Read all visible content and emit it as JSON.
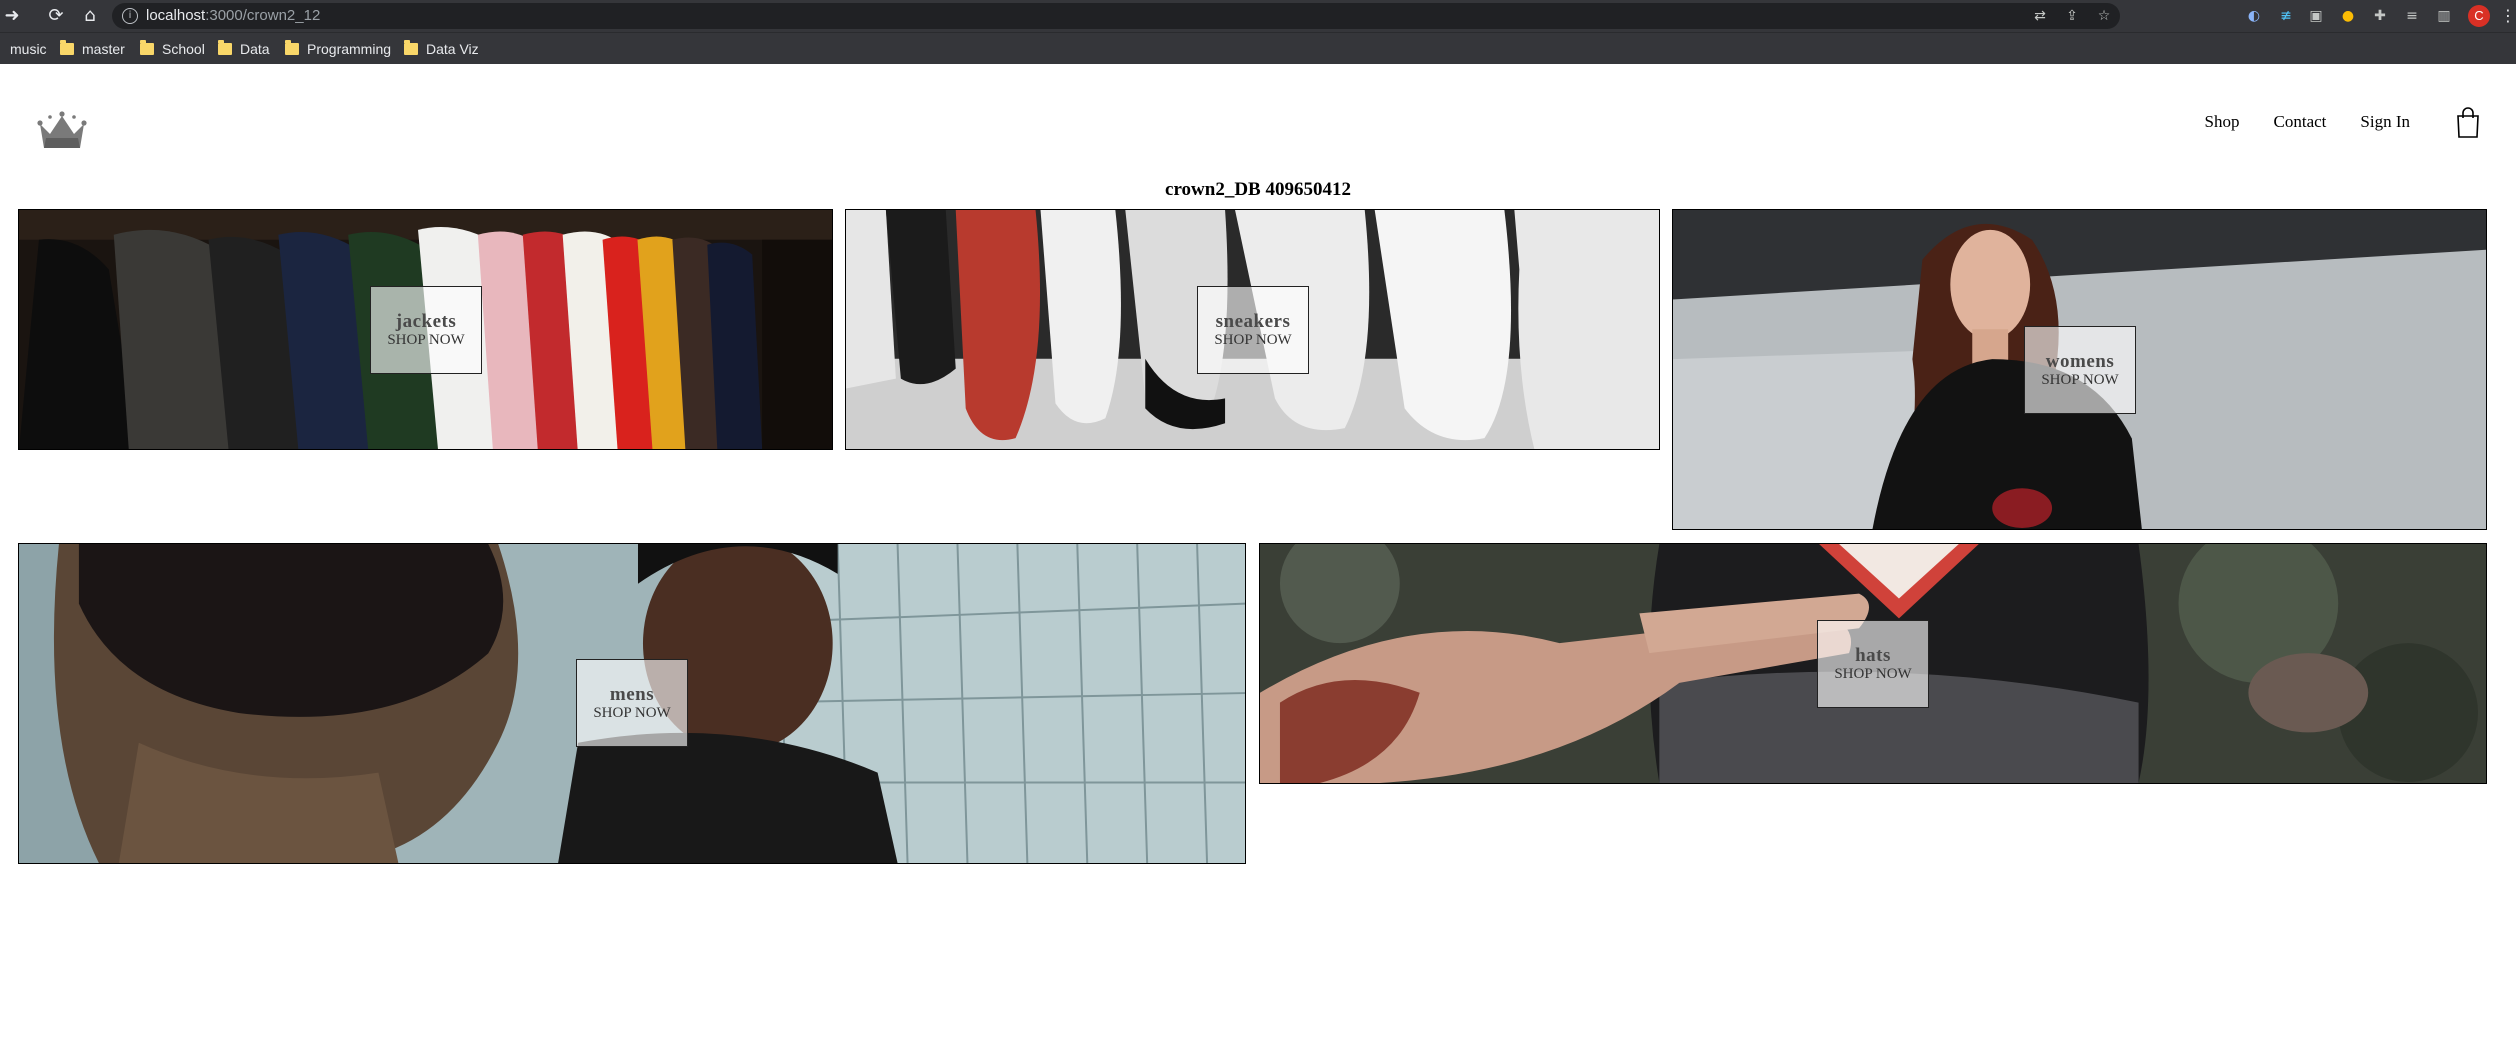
{
  "browser": {
    "url_host": "localhost",
    "url_path": ":3000/crown2_12",
    "bookmarks": [
      {
        "label": "music",
        "folder": false
      },
      {
        "label": "master",
        "folder": true
      },
      {
        "label": "School",
        "folder": true
      },
      {
        "label": "Data",
        "folder": true
      },
      {
        "label": "Programming",
        "folder": true
      },
      {
        "label": "Data Viz",
        "folder": true
      }
    ],
    "profile_initial": "C"
  },
  "header": {
    "logo_icon": "crown-icon",
    "nav": {
      "shop": "Shop",
      "contact": "Contact",
      "sign_in": "Sign In"
    },
    "cart_icon": "shopping-bag-icon"
  },
  "page": {
    "title": "crown2_DB 409650412"
  },
  "directory": {
    "sections": [
      {
        "title": "jackets",
        "subtitle": "SHOP NOW"
      },
      {
        "title": "sneakers",
        "subtitle": "SHOP NOW"
      },
      {
        "title": "womens",
        "subtitle": "SHOP NOW"
      },
      {
        "title": "mens",
        "subtitle": "SHOP NOW"
      },
      {
        "title": "hats",
        "subtitle": "SHOP NOW"
      }
    ]
  },
  "colors": {
    "chrome": "#35363a",
    "omnibox": "#202124",
    "folder": "#f9d769",
    "profile": "#d93025",
    "tile_border": "#000000"
  }
}
